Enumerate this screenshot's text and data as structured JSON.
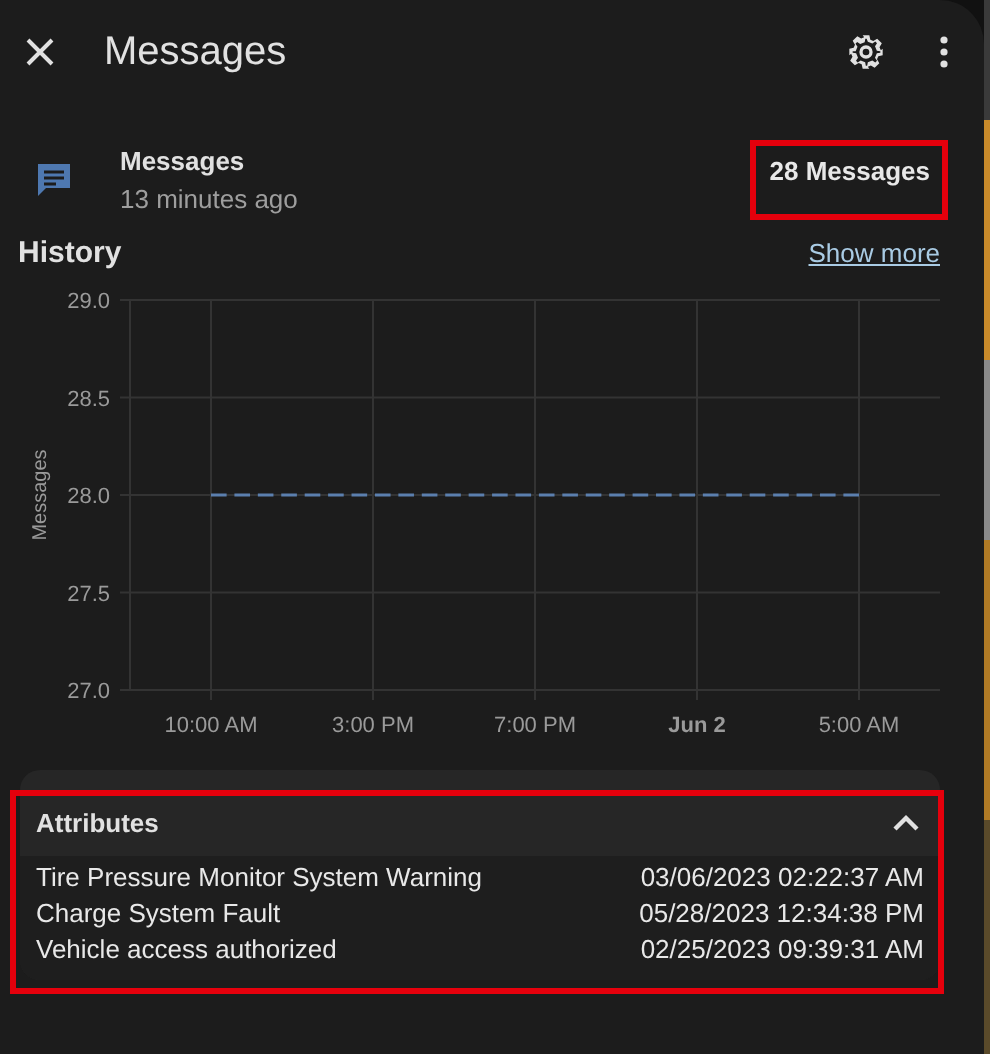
{
  "dialog": {
    "title": "Messages"
  },
  "entity": {
    "name": "Messages",
    "last_changed": "13 minutes ago",
    "state": "28 Messages",
    "highlighted": true
  },
  "history": {
    "title": "History",
    "link": "Show more",
    "chart_data": {
      "type": "line",
      "ylabel": "Messages",
      "categories": [
        "10:00 AM",
        "3:00 PM",
        "7:00 PM",
        "Jun 2",
        "5:00 AM"
      ],
      "ylim": [
        27,
        29
      ],
      "grid": true,
      "yticks": [
        {
          "value": 27,
          "label": "27.0"
        },
        {
          "value": 27.5,
          "label": "27.5"
        },
        {
          "value": 28,
          "label": "28.0"
        },
        {
          "value": 28.5,
          "label": "28.5"
        },
        {
          "value": 29,
          "label": "29.0"
        }
      ],
      "series": [
        {
          "color": "#5b7fae",
          "line_style": "dashed",
          "values": [
            28,
            28,
            28,
            28,
            28
          ]
        }
      ]
    }
  },
  "attributes": {
    "title": "Attributes",
    "expanded": true,
    "highlighted": true,
    "rows": [
      {
        "name": "Tire Pressure Monitor System Warning",
        "value": "03/06/2023 02:22:37 AM"
      },
      {
        "name": "Charge System Fault",
        "value": "05/28/2023 12:34:38 PM"
      },
      {
        "name": "Vehicle access authorized",
        "value": "02/25/2023 09:39:31 AM"
      }
    ]
  }
}
